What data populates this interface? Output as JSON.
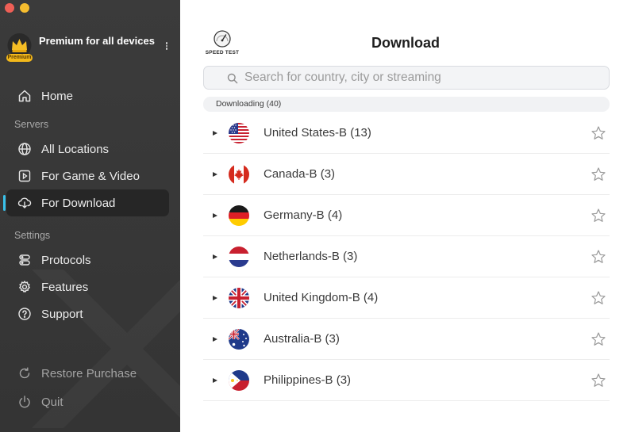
{
  "sidebar": {
    "account_title": "Premium for all devices",
    "premium_badge": "Premium",
    "home": "Home",
    "servers_label": "Servers",
    "all_locations": "All Locations",
    "game_video": "For Game & Video",
    "download": "For Download",
    "settings_label": "Settings",
    "protocols": "Protocols",
    "features": "Features",
    "support": "Support",
    "restore": "Restore Purchase",
    "quit": "Quit"
  },
  "main": {
    "speed_test_label": "SPEED TEST",
    "title": "Download",
    "search_placeholder": "Search for country, city or streaming",
    "group_header": "Downloading (40)",
    "countries": [
      {
        "name": "United States-B (13)"
      },
      {
        "name": "Canada-B (3)"
      },
      {
        "name": "Germany-B (4)"
      },
      {
        "name": "Netherlands-B (3)"
      },
      {
        "name": "United Kingdom-B (4)"
      },
      {
        "name": "Australia-B (3)"
      },
      {
        "name": "Philippines-B (3)"
      }
    ]
  },
  "colors": {
    "accent": "#39c1ea",
    "sidebar_bg": "#3b3b3b",
    "active_item_bg": "#262626",
    "premium_gold": "#f2b81b"
  }
}
